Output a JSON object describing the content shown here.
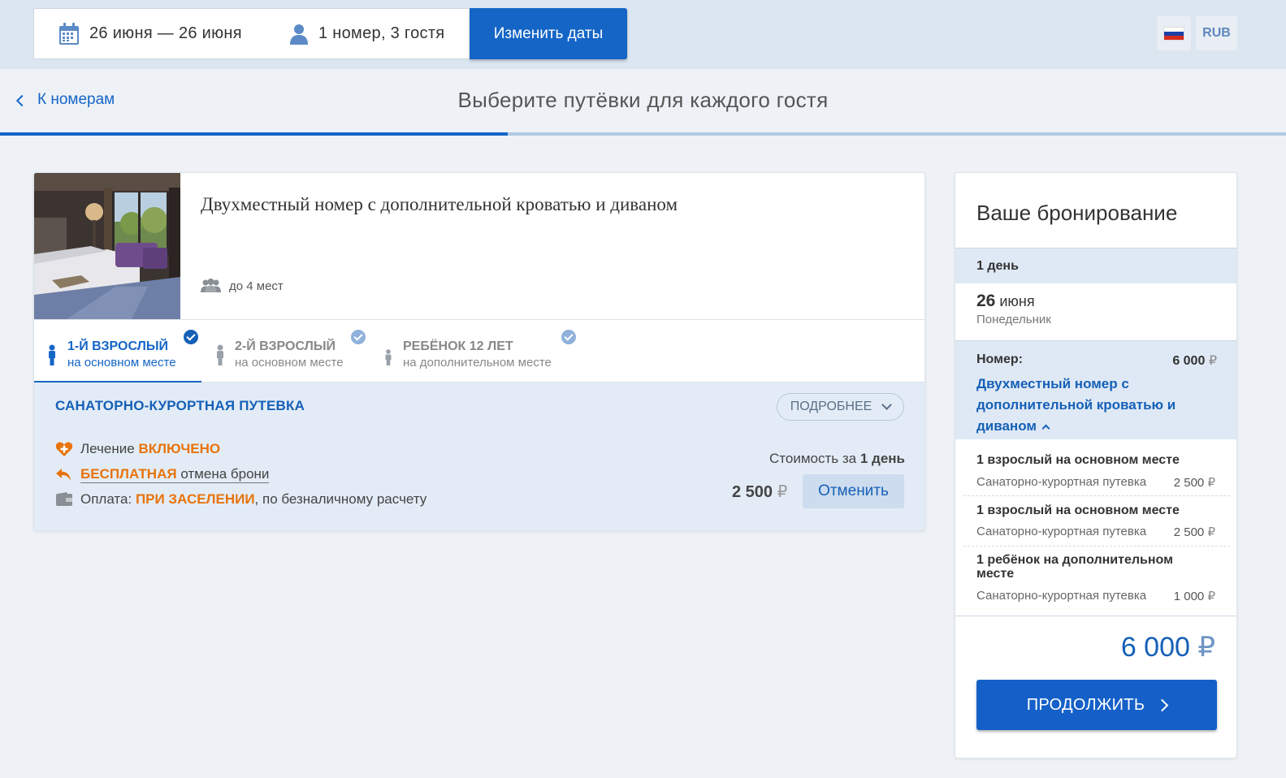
{
  "search": {
    "dates": "26 июня — 26 июня",
    "guests": "1 номер, 3 гостя",
    "change_button": "Изменить даты"
  },
  "locale": {
    "currency": "RUB",
    "flag_colors": [
      "#ffffff",
      "#1c3fa8",
      "#d52b1e"
    ]
  },
  "nav": {
    "back_label": "К номерам",
    "page_title": "Выберите путёвки для каждого гостя",
    "progress_percent": 39.5
  },
  "room": {
    "name": "Двухместный номер с дополнительной кроватью и диваном",
    "capacity": "до 4 мест",
    "guest_tabs": [
      {
        "title": "1-Й ВЗРОСЛЫЙ",
        "sub": "на основном месте"
      },
      {
        "title": "2-Й ВЗРОСЛЫЙ",
        "sub": "на основном месте"
      },
      {
        "title": "РЕБЁНОК  12 ЛЕТ",
        "sub": "на дополнительном месте"
      }
    ]
  },
  "package": {
    "title": "САНАТОРНО-КУРОРТНАЯ ПУТЕВКА",
    "more_button": "ПОДРОБНЕЕ",
    "treatment_label": "Лечение",
    "treatment_value": "ВКЛЮЧЕНО",
    "cancel_value": "БЕСПЛАТНАЯ",
    "cancel_label": "отмена брони",
    "payment_label": "Оплата:",
    "payment_value": "ПРИ ЗАСЕЛЕНИИ",
    "payment_rest": ", по безналичному расчету",
    "cost_label": "Стоимость за",
    "cost_period": "1 день",
    "price": "2 500",
    "currency_symbol": "₽",
    "cancel_button": "Отменить"
  },
  "booking": {
    "title": "Ваше бронирование",
    "days": "1 день",
    "date_day": "26",
    "date_month": "июня",
    "weekday": "Понедельник",
    "room_label": "Номер:",
    "room_price": "6 000",
    "room_name": "Двухместный номер с дополнительной кроватью и диваном",
    "lines": [
      {
        "title": "1 взрослый на основном месте",
        "sub": "Санаторно-курортная путевка",
        "price": "2 500"
      },
      {
        "title": "1 взрослый на основном месте",
        "sub": "Санаторно-курортная путевка",
        "price": "2 500"
      },
      {
        "title": "1 ребёнок на дополнительном месте",
        "sub": "Санаторно-курортная путевка",
        "price": "1 000"
      }
    ],
    "total": "6 000",
    "continue_button": "ПРОДОЛЖИТЬ"
  }
}
